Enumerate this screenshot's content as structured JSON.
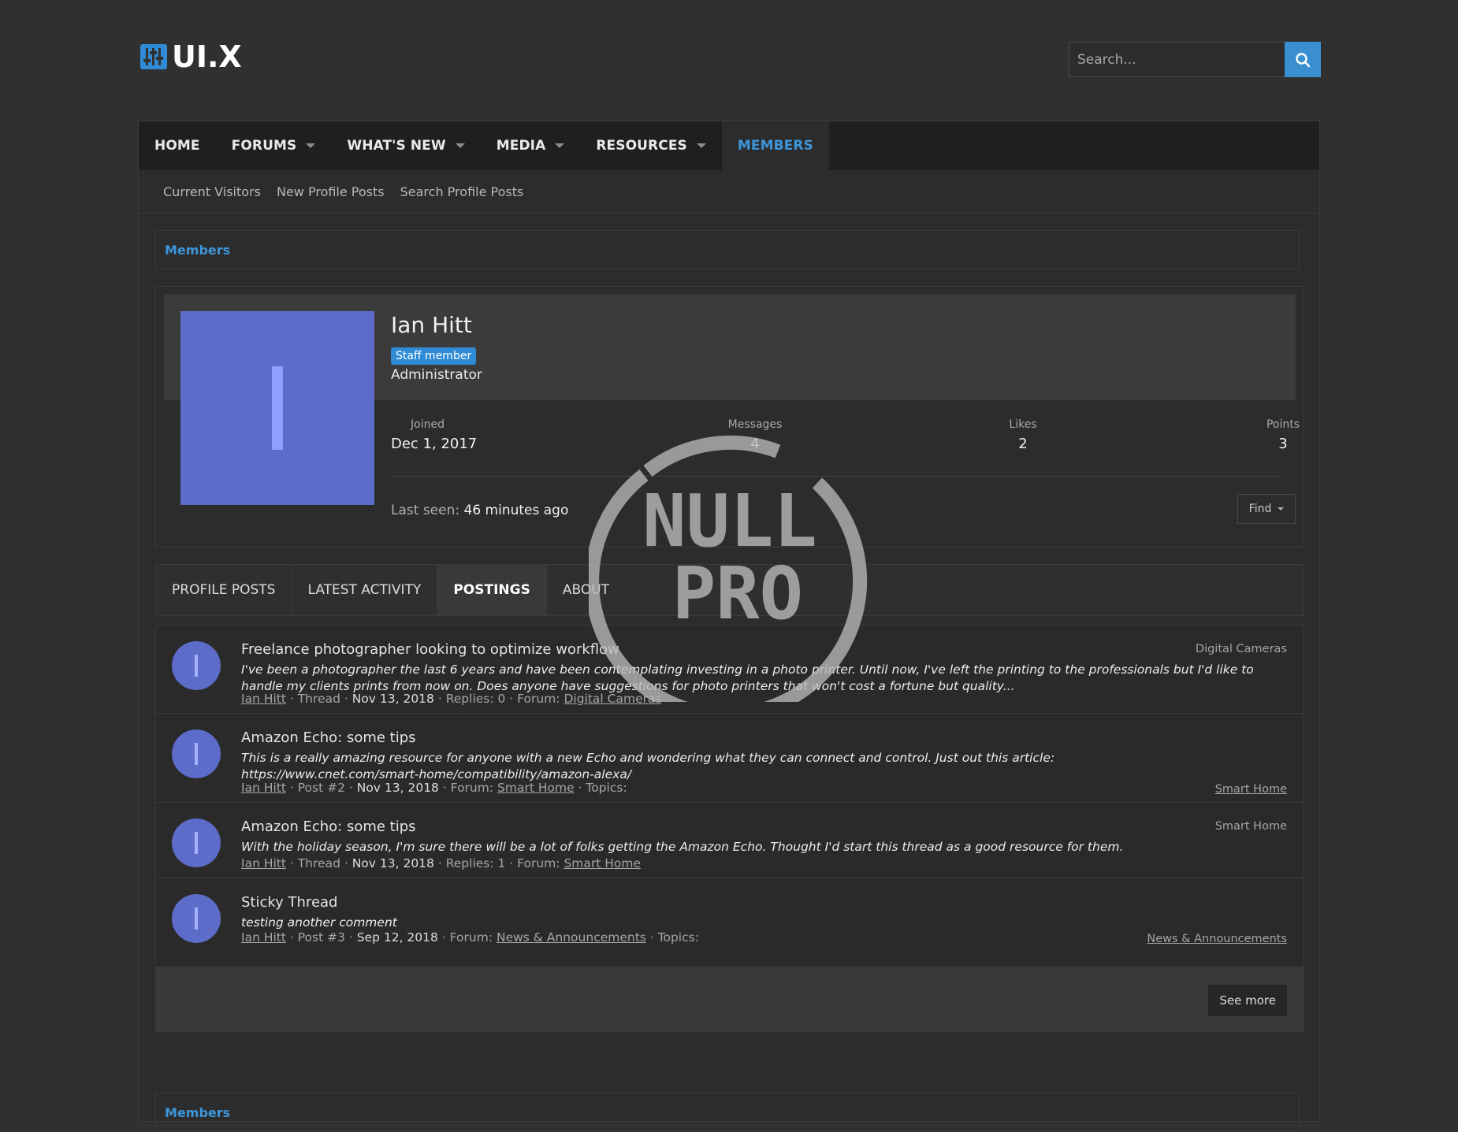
{
  "header": {
    "logo_text": "UI.X",
    "search_placeholder": "Search..."
  },
  "nav": {
    "items": [
      {
        "label": "HOME"
      },
      {
        "label": "FORUMS"
      },
      {
        "label": "WHAT'S NEW"
      },
      {
        "label": "MEDIA"
      },
      {
        "label": "RESOURCES"
      },
      {
        "label": "MEMBERS"
      }
    ],
    "sub_items": [
      "Current Visitors",
      "New Profile Posts",
      "Search Profile Posts"
    ]
  },
  "breadcrumb": {
    "label": "Members"
  },
  "profile": {
    "avatar_letter": "I",
    "name": "Ian Hitt",
    "badge": "Staff member",
    "title": "Administrator",
    "stats": [
      {
        "label": "Joined",
        "value": "Dec 1, 2017"
      },
      {
        "label": "Messages",
        "value": "4"
      },
      {
        "label": "Likes",
        "value": "2"
      },
      {
        "label": "Points",
        "value": "3"
      }
    ],
    "last_seen_label": "Last seen:",
    "last_seen_value": "46 minutes ago",
    "find_label": "Find"
  },
  "tabs": [
    "PROFILE POSTS",
    "LATEST ACTIVITY",
    "POSTINGS",
    "ABOUT"
  ],
  "active_tab": "POSTINGS",
  "postings": [
    {
      "title": "Freelance photographer looking to optimize workflow",
      "snippet": "I've been a photographer the last 6 years and have been contemplating investing in a photo printer. Until now, I've left the printing to the professionals but I'd like to handle my clients prints from now on. Does anyone have suggestions for photo printers that won't cost a fortune but quality...",
      "author": "Ian Hitt",
      "type": "Thread",
      "date": "Nov 13, 2018",
      "extra": "Replies: 0",
      "forum_label": "Forum:",
      "forum": "Digital Cameras",
      "topics_label": "",
      "right_label": "Digital Cameras"
    },
    {
      "title": "Amazon Echo: some tips",
      "snippet": "This is a really amazing resource for anyone with a new Echo and wondering what they can connect and control. Just out this article: https://www.cnet.com/smart-home/compatibility/amazon-alexa/",
      "author": "Ian Hitt",
      "type": "Post #2",
      "date": "Nov 13, 2018",
      "extra": "",
      "forum_label": "Forum:",
      "forum": "Smart Home",
      "topics_label": "Topics:",
      "right_label": "Smart Home"
    },
    {
      "title": "Amazon Echo: some tips",
      "snippet": "With the holiday season, I'm sure there will be a lot of folks getting the Amazon Echo. Thought I'd start this thread as a good resource for them.",
      "author": "Ian Hitt",
      "type": "Thread",
      "date": "Nov 13, 2018",
      "extra": "Replies: 1",
      "forum_label": "Forum:",
      "forum": "Smart Home",
      "topics_label": "",
      "right_label": "Smart Home"
    },
    {
      "title": "Sticky Thread",
      "snippet": "testing another comment",
      "author": "Ian Hitt",
      "type": "Post #3",
      "date": "Sep 12, 2018",
      "extra": "",
      "forum_label": "Forum:",
      "forum": "News & Announcements",
      "topics_label": "Topics:",
      "right_label": "News & Announcements"
    }
  ],
  "see_more": "See more",
  "watermark": {
    "line1": "NULL",
    "line2": "PRO"
  },
  "colors": {
    "accent": "#3d96d9",
    "avatar": "#5d6bc9",
    "background": "#303030",
    "navbar": "#1f1f1f"
  }
}
